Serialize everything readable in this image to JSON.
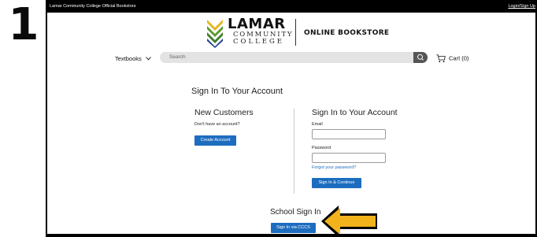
{
  "step_number": "1",
  "topbar": {
    "left_text": "Lamar Community College Official Bookstore",
    "right_link": "Login/Sign Up"
  },
  "logo": {
    "title": "LAMAR",
    "sub_line1": "COMMUNITY",
    "sub_line2": "COLLEGE",
    "store_label": "ONLINE BOOKSTORE"
  },
  "nav": {
    "textbooks_label": "Textbooks",
    "search_placeholder": "Search",
    "cart_label": "Cart (0)"
  },
  "signin": {
    "page_title": "Sign In To Your Account",
    "new_customers": {
      "title": "New Customers",
      "prompt": "Don't have an account?",
      "button": "Create Account"
    },
    "existing": {
      "title": "Sign In to Your Account",
      "email_label": "Email",
      "password_label": "Password",
      "forgot_link": "Forgot your password?",
      "button": "Sign In & Continue"
    },
    "school": {
      "title": "School Sign In",
      "button": "Sign In via CCCS"
    }
  },
  "colors": {
    "accent_blue": "#1d6dbf",
    "arrow_yellow": "#f2b21c",
    "logo_green": "#5a9a2e",
    "logo_yellow": "#e5b51e",
    "logo_blue": "#23408e"
  }
}
